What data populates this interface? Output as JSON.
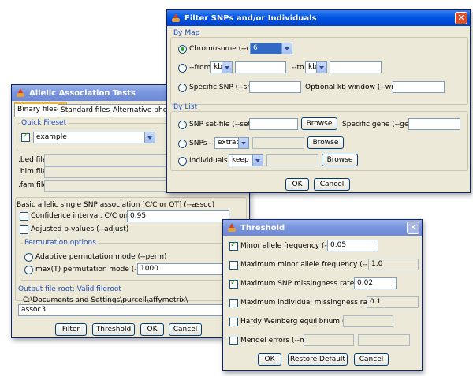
{
  "allelic": {
    "title": "Allelic Association Tests",
    "tabs": [
      "Binary fileset",
      "Standard fileset",
      "Alternative phenotype"
    ],
    "quick_fileset_label": "Quick Fileset",
    "quick_fileset_value": "example",
    "bed_label": ".bed file:",
    "bim_label": ".bim file:",
    "fam_label": ".fam file:",
    "assoc_header": "Basic allelic single SNP association [C/C or QT] (--assoc)",
    "ci_label": "Confidence interval, C/C only (--ci)",
    "ci_value": "0.95",
    "adjust_label": "Adjusted p-values (--adjust)",
    "perm_section": "Permutation options",
    "perm_adaptive": "Adaptive permutation mode (--perm)",
    "perm_max": "max(T) permutation mode (--mperm)",
    "mperm_value": "1000",
    "output_label": "Output file root: Valid fileroot",
    "output_dir": "C:\\Documents and Settings\\purcell\\affymetrix\\",
    "output_name": "assoc3",
    "buttons": {
      "filter": "Filter",
      "threshold": "Threshold",
      "ok": "OK",
      "cancel": "Cancel"
    }
  },
  "filter": {
    "title": "Filter SNPs and/or Individuals",
    "by_map": "By Map",
    "chromosome_label": "Chromosome (--chr)",
    "chromosome_value": "6",
    "from_label": "--from",
    "from_unit": "kb",
    "to_label": "--to",
    "to_unit": "kb",
    "specific_snp_label": "Specific SNP (--snp)",
    "kb_window_label": "Optional kb window (--window)",
    "by_list": "By List",
    "snp_set_label": "SNP set-file (--set)",
    "browse": "Browse",
    "specific_gene_label": "Specific gene (--gene)",
    "snps_label": "SNPs --",
    "snps_mode": "extract",
    "individuals_label": "Individuals --",
    "individuals_mode": "keep",
    "ok": "OK",
    "cancel": "Cancel"
  },
  "threshold": {
    "title": "Threshold",
    "maf_label": "Minor allele frequency (--maf)",
    "maf_value": "0.05",
    "maxmaf_label": "Maximum minor allele frequency (--max-maf)",
    "maxmaf_value": "1.0",
    "geno_label": "Maximum SNP missingness rate (--geno)",
    "geno_value": "0.02",
    "mind_label": "Maximum individual missingness rate (--mind)",
    "mind_value": "0.1",
    "hwe_label": "Hardy Weinberg equilibrium (--hwe)",
    "me_label": "Mendel errors (--me)",
    "ok": "OK",
    "restore": "Restore Default",
    "cancel": "Cancel"
  }
}
